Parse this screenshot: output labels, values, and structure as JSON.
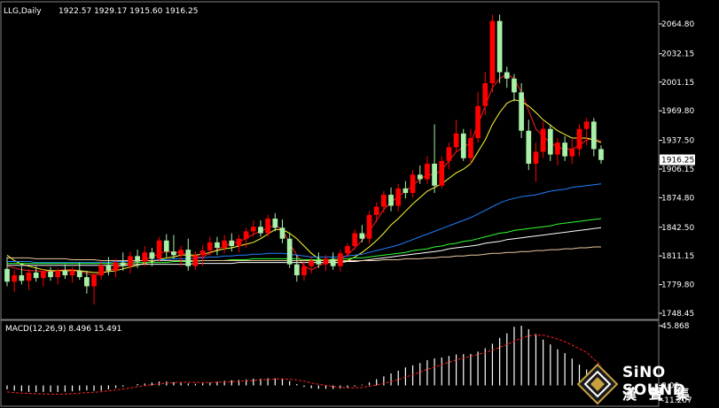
{
  "header": {
    "symbol": "LLG,Daily",
    "ohlc": "1922.57 1929.17 1915.60 1916.25"
  },
  "macd": {
    "label": "MACD(12,26,9) 8.496 15.491"
  },
  "logo": {
    "brand": "SiNO SOUND",
    "cn": "漢聲集"
  },
  "colors": {
    "up": "#ff0000",
    "down": "#a8f0a8",
    "ma_red": "#ff2020",
    "ma_yellow": "#ffff30",
    "ma_blue": "#2080ff",
    "ma_green": "#30ff30",
    "ma_white": "#ffffff",
    "ma_tan": "#e8c8a0",
    "grid": "#808080"
  },
  "chart_data": [
    {
      "type": "candlestick",
      "title": "LLG,Daily",
      "ylim": [
        1748.45,
        2080
      ],
      "y_ticks": [
        "2064.80",
        "2032.15",
        "2001.15",
        "1969.80",
        "1937.50",
        "1906.15",
        "1874.80",
        "1842.50",
        "1811.15",
        "1779.80",
        "1748.45"
      ],
      "last_price": "1916.25",
      "candles": [
        [
          1797,
          1810,
          1778,
          1783
        ],
        [
          1783,
          1796,
          1772,
          1790
        ],
        [
          1790,
          1800,
          1780,
          1784
        ],
        [
          1784,
          1797,
          1774,
          1793
        ],
        [
          1793,
          1800,
          1783,
          1787
        ],
        [
          1787,
          1797,
          1778,
          1794
        ],
        [
          1794,
          1799,
          1784,
          1788
        ],
        [
          1788,
          1798,
          1780,
          1795
        ],
        [
          1795,
          1802,
          1786,
          1790
        ],
        [
          1790,
          1799,
          1782,
          1795
        ],
        [
          1795,
          1804,
          1785,
          1788
        ],
        [
          1788,
          1795,
          1770,
          1778
        ],
        [
          1778,
          1793,
          1758,
          1790
        ],
        [
          1790,
          1806,
          1785,
          1801
        ],
        [
          1801,
          1810,
          1790,
          1795
        ],
        [
          1795,
          1808,
          1788,
          1804
        ],
        [
          1804,
          1815,
          1795,
          1800
        ],
        [
          1800,
          1816,
          1792,
          1811
        ],
        [
          1811,
          1818,
          1798,
          1805
        ],
        [
          1805,
          1822,
          1800,
          1815
        ],
        [
          1815,
          1820,
          1800,
          1808
        ],
        [
          1808,
          1832,
          1805,
          1828
        ],
        [
          1828,
          1835,
          1810,
          1816
        ],
        [
          1816,
          1834,
          1808,
          1812
        ],
        [
          1812,
          1822,
          1800,
          1818
        ],
        [
          1818,
          1830,
          1795,
          1800
        ],
        [
          1800,
          1816,
          1796,
          1812
        ],
        [
          1812,
          1823,
          1800,
          1817
        ],
        [
          1817,
          1832,
          1812,
          1826
        ],
        [
          1826,
          1832,
          1812,
          1820
        ],
        [
          1820,
          1834,
          1814,
          1828
        ],
        [
          1828,
          1836,
          1816,
          1822
        ],
        [
          1822,
          1834,
          1815,
          1830
        ],
        [
          1830,
          1842,
          1820,
          1838
        ],
        [
          1838,
          1850,
          1832,
          1843
        ],
        [
          1843,
          1850,
          1832,
          1836
        ],
        [
          1836,
          1856,
          1832,
          1852
        ],
        [
          1852,
          1858,
          1838,
          1842
        ],
        [
          1842,
          1851,
          1825,
          1830
        ],
        [
          1830,
          1836,
          1798,
          1802
        ],
        [
          1802,
          1812,
          1783,
          1790
        ],
        [
          1790,
          1806,
          1784,
          1800
        ],
        [
          1800,
          1810,
          1792,
          1806
        ],
        [
          1806,
          1815,
          1798,
          1802
        ],
        [
          1802,
          1812,
          1795,
          1808
        ],
        [
          1808,
          1815,
          1796,
          1800
        ],
        [
          1800,
          1818,
          1794,
          1814
        ],
        [
          1814,
          1825,
          1810,
          1822
        ],
        [
          1822,
          1840,
          1818,
          1836
        ],
        [
          1836,
          1845,
          1826,
          1830
        ],
        [
          1830,
          1860,
          1825,
          1856
        ],
        [
          1856,
          1870,
          1848,
          1865
        ],
        [
          1865,
          1882,
          1858,
          1878
        ],
        [
          1878,
          1886,
          1860,
          1866
        ],
        [
          1866,
          1890,
          1860,
          1885
        ],
        [
          1885,
          1893,
          1874,
          1880
        ],
        [
          1880,
          1905,
          1875,
          1900
        ],
        [
          1900,
          1910,
          1890,
          1895
        ],
        [
          1895,
          1920,
          1890,
          1912
        ],
        [
          1912,
          1955,
          1880,
          1888
        ],
        [
          1888,
          1920,
          1885,
          1915
        ],
        [
          1915,
          1935,
          1906,
          1930
        ],
        [
          1930,
          1960,
          1925,
          1945
        ],
        [
          1945,
          1950,
          1915,
          1918
        ],
        [
          1918,
          1950,
          1912,
          1940
        ],
        [
          1940,
          1990,
          1935,
          1975
        ],
        [
          1975,
          2012,
          1965,
          2000
        ],
        [
          2000,
          2075,
          1990,
          2068
        ],
        [
          2068,
          2075,
          2000,
          2012
        ],
        [
          2012,
          2018,
          1995,
          2005
        ],
        [
          2005,
          2010,
          1980,
          1990
        ],
        [
          1990,
          2000,
          1940,
          1948
        ],
        [
          1948,
          1960,
          1905,
          1912
        ],
        [
          1912,
          1935,
          1892,
          1925
        ],
        [
          1925,
          1958,
          1918,
          1950
        ],
        [
          1950,
          1955,
          1915,
          1922
        ],
        [
          1922,
          1940,
          1910,
          1935
        ],
        [
          1935,
          1942,
          1915,
          1920
        ],
        [
          1920,
          1940,
          1912,
          1928
        ],
        [
          1928,
          1955,
          1920,
          1950
        ],
        [
          1950,
          1962,
          1932,
          1958
        ],
        [
          1958,
          1962,
          1920,
          1928
        ],
        [
          1928,
          1932,
          1912,
          1916
        ]
      ],
      "series": [
        {
          "values": [
            1800,
            1798,
            1796,
            1795,
            1795,
            1794,
            1794,
            1795,
            1796,
            1796,
            1795,
            1792,
            1790,
            1792,
            1795,
            1798,
            1801,
            1803,
            1805,
            1807,
            1810,
            1814,
            1816,
            1815,
            1815,
            1812,
            1810,
            1810,
            1814,
            1818,
            1822,
            1825,
            1827,
            1830,
            1835,
            1838,
            1842,
            1844,
            1840,
            1825,
            1812,
            1800,
            1796,
            1800,
            1804,
            1805,
            1808,
            1812,
            1820,
            1828,
            1838,
            1850,
            1862,
            1870,
            1876,
            1882,
            1888,
            1895,
            1900,
            1900,
            1905,
            1915,
            1925,
            1930,
            1935,
            1955,
            1975,
            1995,
            2005,
            2010,
            2005,
            1990,
            1970,
            1950,
            1942,
            1935,
            1930,
            1928,
            1928,
            1932,
            1938,
            1940,
            1936
          ],
          "color_key": "ma_red"
        },
        {
          "values": [
            1812,
            1806,
            1802,
            1800,
            1798,
            1796,
            1795,
            1795,
            1795,
            1795,
            1795,
            1794,
            1793,
            1793,
            1794,
            1795,
            1797,
            1799,
            1801,
            1803,
            1805,
            1807,
            1809,
            1810,
            1812,
            1812,
            1812,
            1813,
            1815,
            1817,
            1819,
            1820,
            1822,
            1824,
            1826,
            1830,
            1835,
            1840,
            1840,
            1836,
            1830,
            1822,
            1814,
            1808,
            1805,
            1804,
            1804,
            1806,
            1810,
            1815,
            1821,
            1828,
            1836,
            1845,
            1852,
            1860,
            1868,
            1875,
            1882,
            1886,
            1890,
            1896,
            1902,
            1906,
            1912,
            1925,
            1938,
            1955,
            1968,
            1978,
            1982,
            1980,
            1975,
            1968,
            1960,
            1954,
            1948,
            1944,
            1940,
            1940,
            1940,
            1938,
            1935
          ],
          "color_key": "ma_yellow"
        },
        {
          "values": [
            1805,
            1805,
            1805,
            1805,
            1804,
            1804,
            1804,
            1804,
            1804,
            1804,
            1804,
            1804,
            1804,
            1804,
            1804,
            1805,
            1805,
            1805,
            1806,
            1806,
            1806,
            1807,
            1807,
            1808,
            1808,
            1808,
            1809,
            1809,
            1810,
            1810,
            1811,
            1811,
            1812,
            1812,
            1813,
            1813,
            1814,
            1814,
            1814,
            1813,
            1812,
            1811,
            1810,
            1810,
            1810,
            1810,
            1810,
            1811,
            1812,
            1813,
            1815,
            1817,
            1819,
            1821,
            1823,
            1826,
            1829,
            1832,
            1835,
            1838,
            1841,
            1844,
            1847,
            1850,
            1853,
            1857,
            1861,
            1865,
            1869,
            1872,
            1874,
            1876,
            1877,
            1878,
            1880,
            1882,
            1883,
            1884,
            1886,
            1887,
            1888,
            1889,
            1890
          ],
          "color_key": "ma_blue"
        },
        {
          "values": [
            1803,
            1803,
            1803,
            1803,
            1803,
            1803,
            1803,
            1803,
            1803,
            1803,
            1803,
            1803,
            1803,
            1803,
            1803,
            1803,
            1803,
            1803,
            1804,
            1804,
            1804,
            1804,
            1804,
            1805,
            1805,
            1805,
            1805,
            1806,
            1806,
            1806,
            1806,
            1807,
            1807,
            1807,
            1808,
            1808,
            1808,
            1808,
            1808,
            1808,
            1808,
            1807,
            1807,
            1807,
            1807,
            1807,
            1808,
            1808,
            1809,
            1809,
            1810,
            1811,
            1812,
            1813,
            1814,
            1815,
            1817,
            1818,
            1819,
            1821,
            1822,
            1824,
            1825,
            1827,
            1828,
            1830,
            1832,
            1834,
            1836,
            1837,
            1839,
            1840,
            1841,
            1842,
            1843,
            1844,
            1846,
            1847,
            1848,
            1849,
            1850,
            1851,
            1852
          ],
          "color_key": "ma_green"
        },
        {
          "values": [
            1801,
            1801,
            1801,
            1801,
            1801,
            1801,
            1801,
            1801,
            1801,
            1801,
            1801,
            1801,
            1801,
            1801,
            1801,
            1801,
            1801,
            1801,
            1802,
            1802,
            1802,
            1802,
            1802,
            1802,
            1802,
            1802,
            1803,
            1803,
            1803,
            1803,
            1803,
            1803,
            1804,
            1804,
            1804,
            1804,
            1804,
            1804,
            1804,
            1804,
            1804,
            1804,
            1804,
            1804,
            1804,
            1804,
            1804,
            1805,
            1805,
            1806,
            1807,
            1808,
            1809,
            1810,
            1811,
            1812,
            1813,
            1814,
            1815,
            1816,
            1817,
            1819,
            1820,
            1821,
            1822,
            1823,
            1825,
            1826,
            1827,
            1829,
            1830,
            1831,
            1832,
            1833,
            1834,
            1835,
            1836,
            1837,
            1838,
            1839,
            1840,
            1841,
            1842
          ],
          "color_key": "ma_white"
        },
        {
          "values": [
            1809,
            1809,
            1809,
            1809,
            1808,
            1808,
            1808,
            1808,
            1808,
            1807,
            1807,
            1807,
            1807,
            1806,
            1806,
            1806,
            1806,
            1806,
            1806,
            1806,
            1806,
            1806,
            1806,
            1806,
            1806,
            1806,
            1806,
            1806,
            1806,
            1806,
            1806,
            1806,
            1806,
            1806,
            1806,
            1806,
            1806,
            1806,
            1806,
            1806,
            1806,
            1806,
            1806,
            1806,
            1806,
            1806,
            1806,
            1806,
            1806,
            1806,
            1806,
            1806,
            1807,
            1807,
            1807,
            1808,
            1808,
            1808,
            1809,
            1809,
            1810,
            1810,
            1811,
            1811,
            1812,
            1812,
            1813,
            1814,
            1814,
            1815,
            1815,
            1816,
            1816,
            1817,
            1817,
            1818,
            1818,
            1819,
            1819,
            1820,
            1820,
            1821,
            1821
          ],
          "color_key": "ma_tan"
        }
      ]
    },
    {
      "type": "bar",
      "title": "MACD(12,26,9) 8.496 15.491",
      "ylim": [
        -11.207,
        45.868
      ],
      "y_ticks": [
        "45.868",
        "0.00",
        "-11.207"
      ],
      "histogram": [
        -3,
        -4,
        -4.5,
        -5,
        -5,
        -5,
        -5,
        -5,
        -4.8,
        -4.5,
        -4,
        -3.8,
        -4.2,
        -4,
        -3,
        -2,
        -1,
        0,
        1,
        1.5,
        2.2,
        3,
        3,
        2.5,
        2,
        1.5,
        1.3,
        1.6,
        2.2,
        3,
        3.6,
        4,
        4.2,
        4.6,
        5.2,
        5.2,
        5.5,
        5.4,
        5,
        3.4,
        1,
        -1.2,
        -2.2,
        -2.6,
        -2.6,
        -2.7,
        -2.4,
        -1.8,
        -0.8,
        0.6,
        2.4,
        4.8,
        7,
        9.2,
        11.3,
        13.8,
        15.4,
        17.2,
        19.4,
        20.8,
        21.5,
        22.6,
        23.8,
        24,
        24.2,
        26,
        28.5,
        32,
        36.5,
        40,
        45,
        45.8,
        43.2,
        39.5,
        35.2,
        31.5,
        27.8,
        24.8,
        20.6,
        16,
        12.2,
        9.8,
        8.496
      ],
      "signal": [
        -5,
        -5.5,
        -6,
        -6.2,
        -6.4,
        -6.6,
        -6.7,
        -6.7,
        -6.6,
        -6.3,
        -6,
        -5.5,
        -5.2,
        -4.8,
        -4.2,
        -3.5,
        -2.8,
        -2,
        -1,
        -0.2,
        0.6,
        1.2,
        1.8,
        2.2,
        2.4,
        2.4,
        2.3,
        2.2,
        2.2,
        2.4,
        2.6,
        2.9,
        3.2,
        3.5,
        3.9,
        4.3,
        4.6,
        4.9,
        5,
        4.8,
        4.2,
        3.2,
        2,
        0.9,
        0,
        -0.8,
        -1.4,
        -1.8,
        -1.8,
        -1.5,
        -0.7,
        0.3,
        1.6,
        3,
        4.6,
        6.3,
        8.2,
        10.2,
        12.3,
        14.2,
        16,
        17.9,
        19.6,
        21.1,
        22.4,
        23.8,
        25.3,
        27.1,
        29.2,
        31.4,
        33.9,
        36.5,
        38.1,
        38.7,
        38.5,
        37.3,
        35.6,
        33.6,
        31,
        28.1,
        25.4,
        20.2,
        15.491
      ]
    }
  ]
}
